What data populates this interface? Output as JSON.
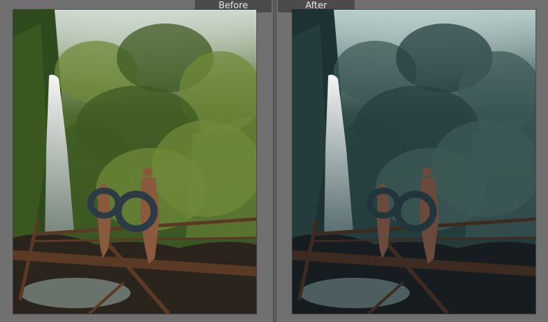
{
  "compare": {
    "before_label": "Before",
    "after_label": "After"
  },
  "palette": {
    "before": {
      "sky": "#cfd9cf",
      "canopy": "#4f6a2e",
      "foliage": "#3d5a22",
      "cliff": "#2f4a1c",
      "moss": "#6f8a3a",
      "rock": "#2a241c",
      "water": "#7f8c86",
      "wood": "#5a3a24",
      "skin": "#8a5a3c",
      "tube": "#2b3a44"
    },
    "after": {
      "sky": "#b7cccb",
      "canopy": "#2f4a48",
      "foliage": "#26403f",
      "cliff": "#1e3234",
      "moss": "#3d5a57",
      "rock": "#161c1f",
      "water": "#5f7476",
      "wood": "#3d2b22",
      "skin": "#6a4a3c",
      "tube": "#22343c"
    }
  }
}
